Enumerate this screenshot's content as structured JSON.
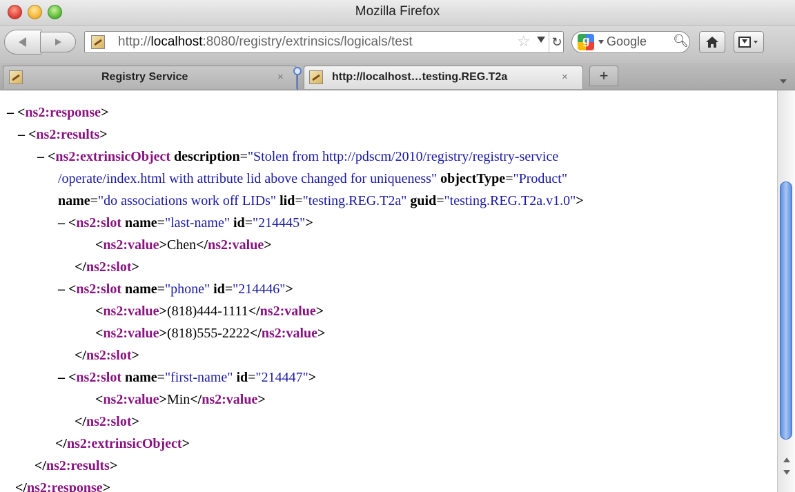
{
  "window": {
    "title": "Mozilla Firefox"
  },
  "toolbar": {
    "url_prefix": "http://",
    "url_host": "localhost",
    "url_rest": ":8080/registry/extrinsics/logicals/test",
    "search_placeholder": "Google"
  },
  "tabs": [
    {
      "label": "Registry Service",
      "close": "×"
    },
    {
      "label": "http://localhost…testing.REG.T2a",
      "close": "×"
    }
  ],
  "newtab_label": "+",
  "xml": {
    "collapse_marker": "–",
    "response_tag": "ns2:response",
    "results_tag": "ns2:results",
    "extrinsic_tag": "ns2:extrinsicObject",
    "slot_tag": "ns2:slot",
    "value_tag": "ns2:value",
    "extrinsic_attrs": {
      "description_name": "description",
      "description_value_1": "\"Stolen from http://pdscm/2010/registry/registry-service",
      "description_value_2": "/operate/index.html with attribute lid above changed for uniqueness\"",
      "objectType_name": "objectType",
      "objectType_value": "\"Product\"",
      "name_name": "name",
      "name_value": "\"do associations work off LIDs\"",
      "lid_name": "lid",
      "lid_value": "\"testing.REG.T2a\"",
      "guid_name": "guid",
      "guid_value": "\"testing.REG.T2a.v1.0\""
    },
    "slots": [
      {
        "name_attr": "name",
        "name_value": "\"last-name\"",
        "id_attr": "id",
        "id_value": "\"214445\"",
        "values": [
          "Chen"
        ]
      },
      {
        "name_attr": "name",
        "name_value": "\"phone\"",
        "id_attr": "id",
        "id_value": "\"214446\"",
        "values": [
          "(818)444-1111",
          "(818)555-2222"
        ]
      },
      {
        "name_attr": "name",
        "name_value": "\"first-name\"",
        "id_attr": "id",
        "id_value": "\"214447\"",
        "values": [
          "Min"
        ]
      }
    ]
  },
  "icons": {
    "back": "back-arrow-icon",
    "forward": "forward-arrow-icon",
    "star": "star-icon",
    "reload": "reload-icon",
    "search": "search-icon",
    "home": "home-icon",
    "bookmarks": "bookmarks-icon"
  },
  "colors": {
    "tag": "#881280",
    "attr_value": "#1a1aa6",
    "scroll_thumb": "#5b8ee0"
  }
}
